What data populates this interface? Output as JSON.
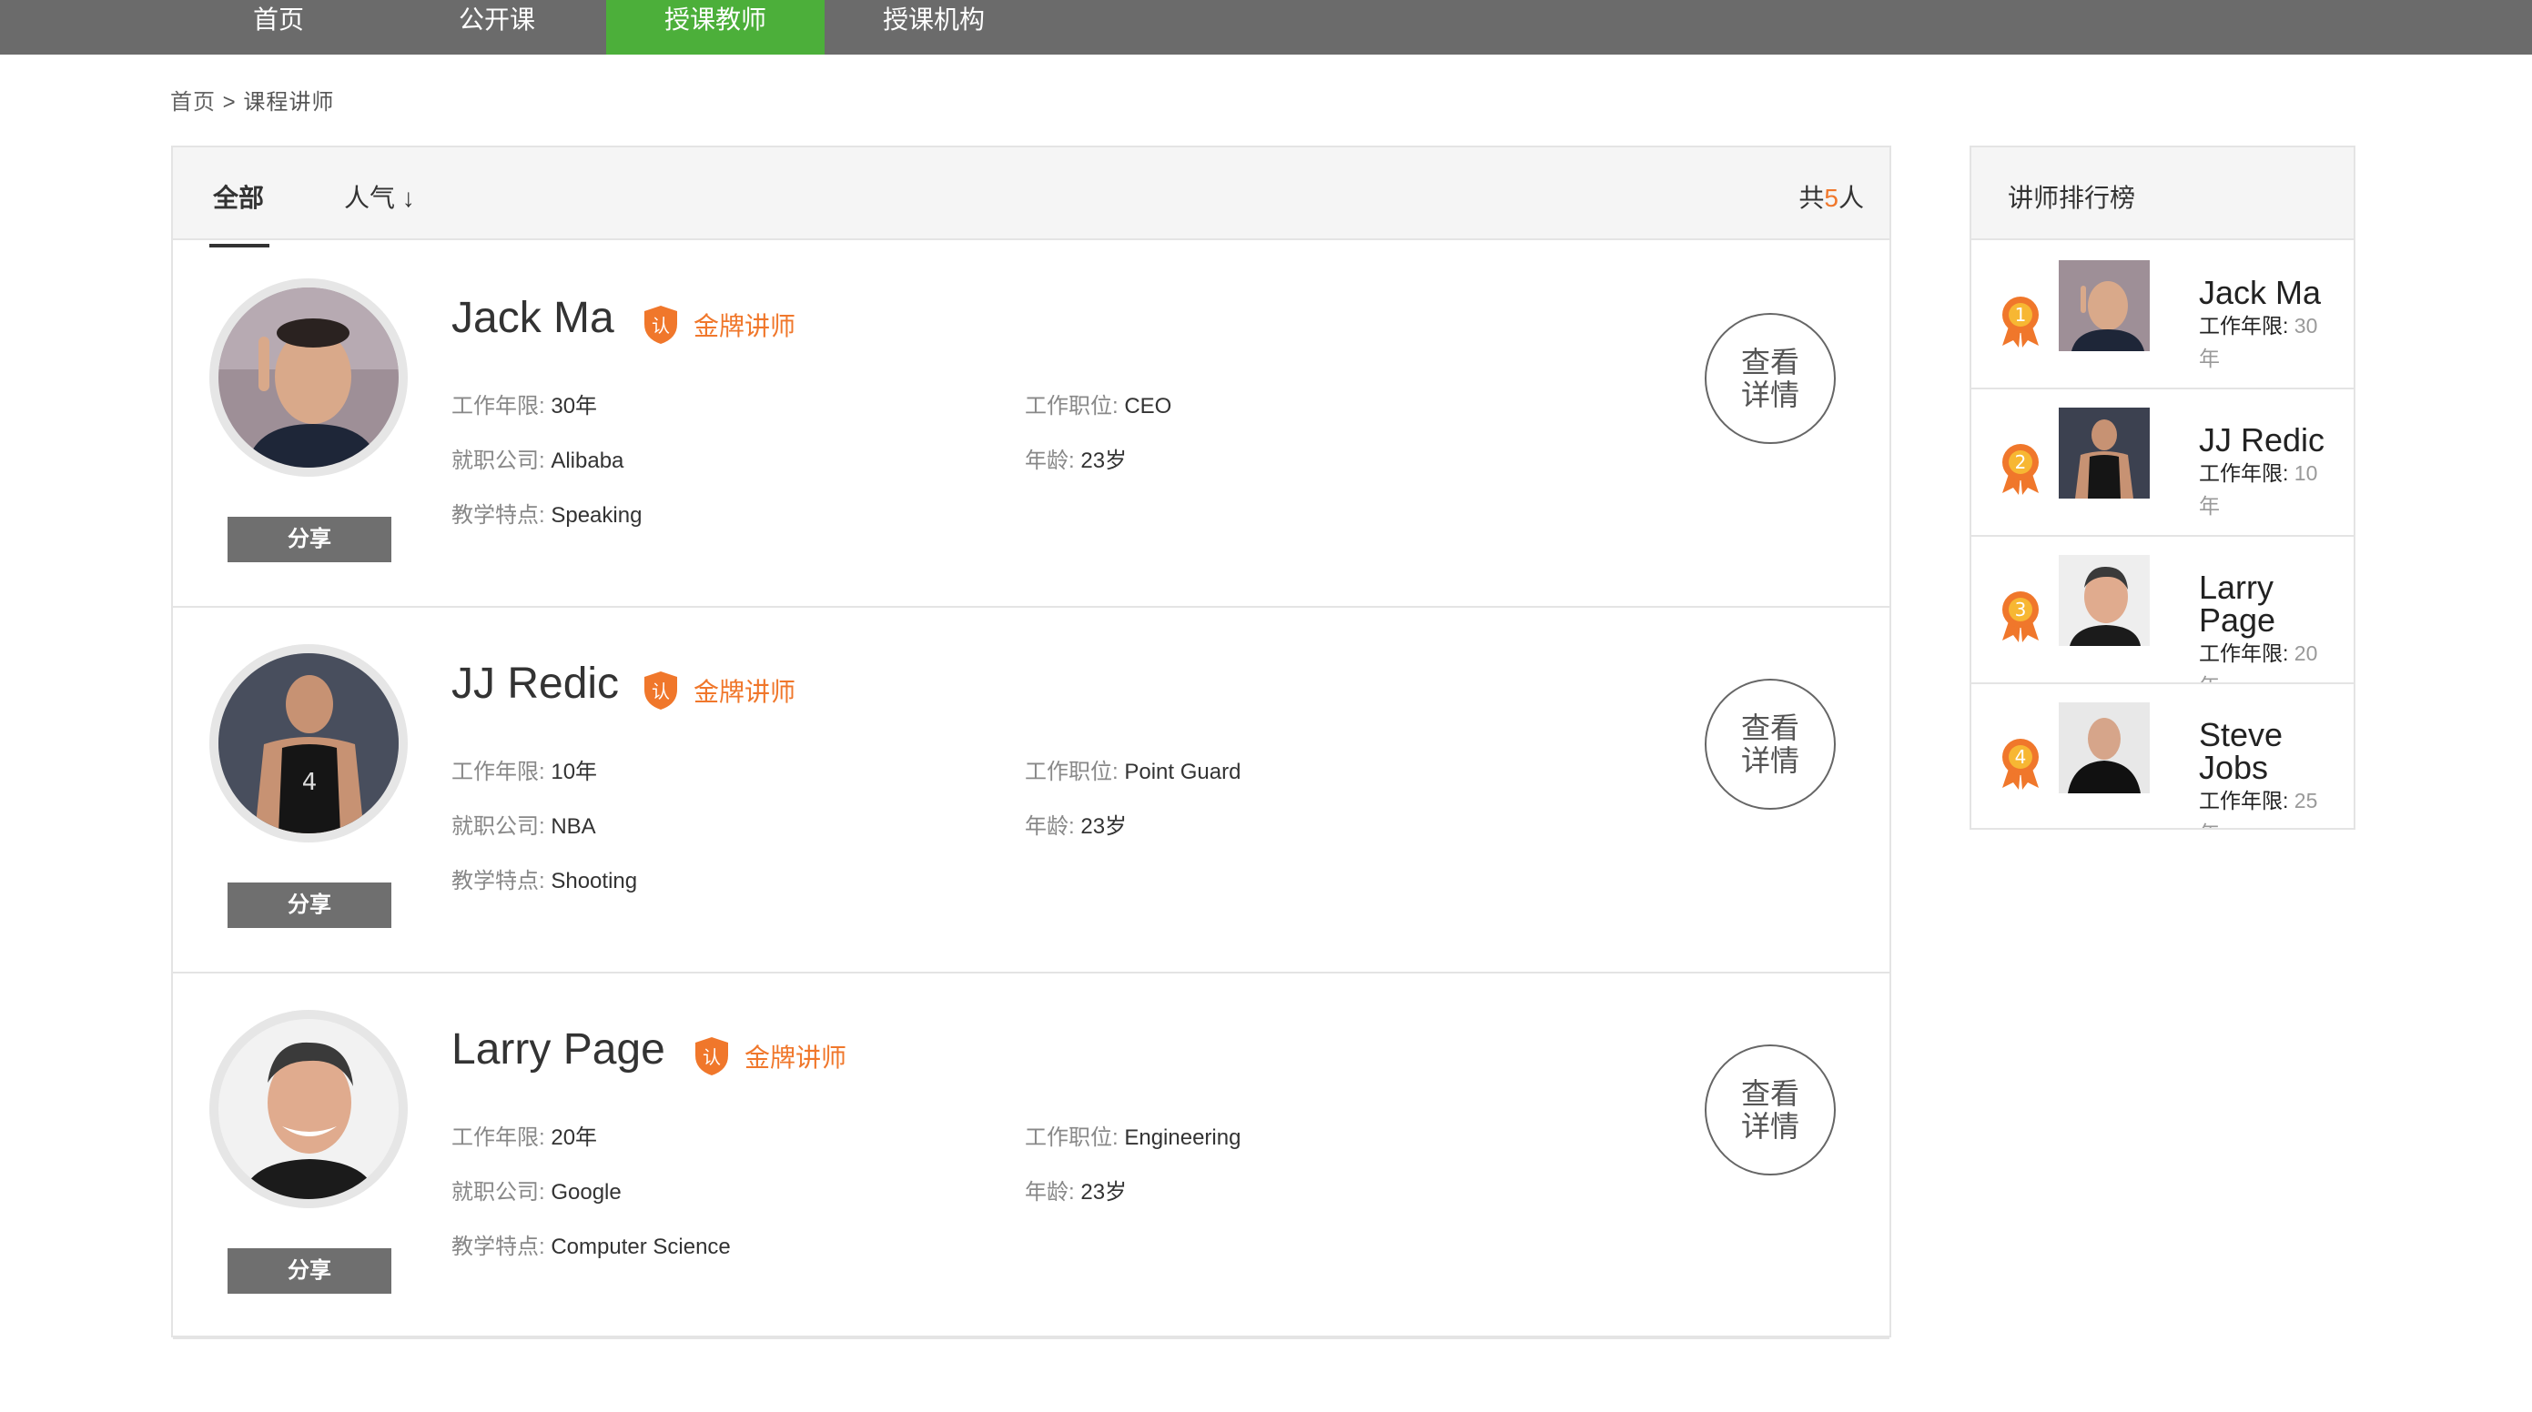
{
  "nav": {
    "items": [
      "首页",
      "公开课",
      "授课教师",
      "授课机构"
    ],
    "active_index": 2
  },
  "breadcrumb": {
    "home": "首页",
    "separator": ">",
    "current": "课程讲师"
  },
  "filter": {
    "tab_all": "全部",
    "tab_popularity": "人气 ↓",
    "total_prefix": "共",
    "total_count": "5",
    "total_suffix": "人"
  },
  "labels": {
    "years": "工作年限:",
    "position": "工作职位:",
    "company": "就职公司:",
    "age": "年龄:",
    "feature": "教学特点:",
    "badge": "金牌讲师",
    "badge_icon_char": "认",
    "share": "分享",
    "detail_line1": "查看",
    "detail_line2": "详情"
  },
  "teachers": [
    {
      "name": "Jack Ma",
      "years": "30年",
      "position": "CEO",
      "company": "Alibaba",
      "age": "23岁",
      "feature": "Speaking"
    },
    {
      "name": "JJ Redic",
      "years": "10年",
      "position": "Point Guard",
      "company": "NBA",
      "age": "23岁",
      "feature": "Shooting"
    },
    {
      "name": "Larry Page",
      "years": "20年",
      "position": "Engineering",
      "company": "Google",
      "age": "23岁",
      "feature": "Computer Science"
    }
  ],
  "ranking": {
    "title": "讲师排行榜",
    "years_label": "工作年限:",
    "items": [
      {
        "rank": "1",
        "name": "Jack Ma",
        "years_value": "30",
        "years_unit": "年"
      },
      {
        "rank": "2",
        "name": "JJ Redic",
        "years_value": "10",
        "years_unit": "年"
      },
      {
        "rank": "3",
        "name": "Larry Page",
        "years_value": "20",
        "years_unit": "年"
      },
      {
        "rank": "4",
        "name": "Steve Jobs",
        "years_value": "25",
        "years_unit": "年"
      }
    ]
  },
  "colors": {
    "nav_bg": "#6b6b6b",
    "nav_active": "#4caf3a",
    "accent_orange": "#f0772b"
  }
}
